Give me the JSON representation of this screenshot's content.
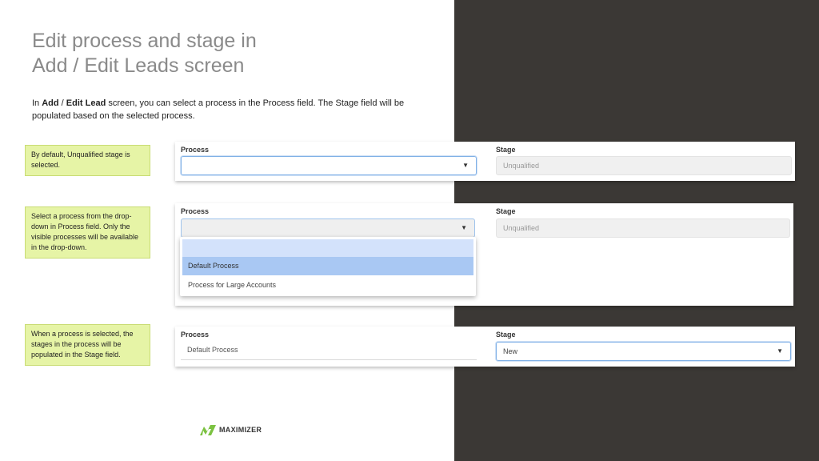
{
  "title_line1": "Edit process and stage in",
  "title_line2": "Add / Edit Leads screen",
  "intro": {
    "prefix": "In ",
    "add": "Add",
    "sep": " / ",
    "edit_lead": "Edit Lead",
    "suffix": " screen, you can select a process in the Process field. The Stage field will be populated based on the selected process."
  },
  "callouts": [
    "By default, Unqualified stage is selected.",
    "Select a process from the drop-down in Process field. Only the visible processes will be available in the drop-down.",
    "When a process is selected, the stages in the process will be populated in the Stage field."
  ],
  "panel1": {
    "process_label": "Process",
    "process_value": "",
    "stage_label": "Stage",
    "stage_value": "Unqualified"
  },
  "panel2": {
    "process_label": "Process",
    "process_value": "",
    "stage_label": "Stage",
    "stage_value": "Unqualified",
    "dropdown_options": [
      "",
      "Default Process",
      "Process for Large Accounts"
    ]
  },
  "panel3": {
    "process_label": "Process",
    "process_value": "Default Process",
    "stage_label": "Stage",
    "stage_value": "New"
  },
  "caret_glyph": "▼",
  "logo_text": "MAXIMIZER",
  "colors": {
    "dark_panel": "#3b3835",
    "callout_bg": "#e6f4a6",
    "logo_green": "#7cc242",
    "dropdown_selected": "#a9c8f3"
  }
}
